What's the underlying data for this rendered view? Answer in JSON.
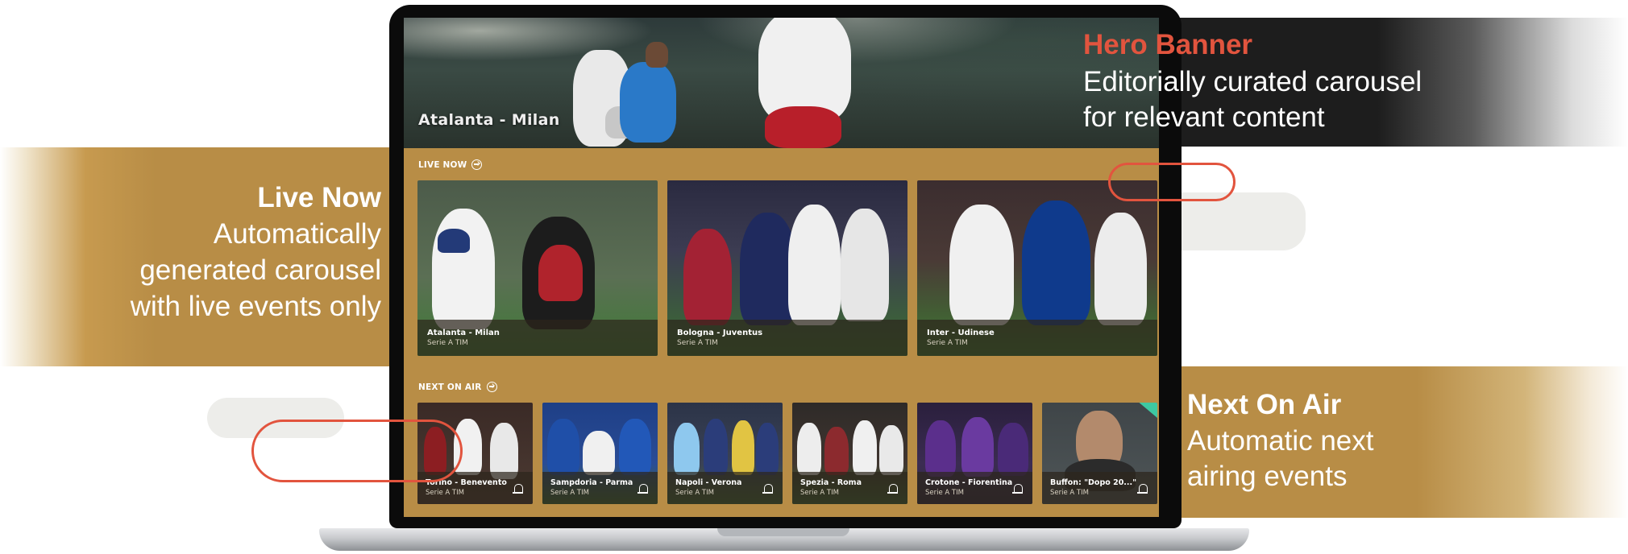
{
  "colors": {
    "gold": "#b88d46",
    "accent": "#e2543e",
    "dark_band": "#1d1d1d"
  },
  "hero": {
    "title": "Atalanta - Milan"
  },
  "live_now": {
    "heading": "LIVE NOW",
    "items": [
      {
        "title": "Atalanta - Milan",
        "subtitle": "Serie A TIM"
      },
      {
        "title": "Bologna - Juventus",
        "subtitle": "Serie A TIM"
      },
      {
        "title": "Inter - Udinese",
        "subtitle": "Serie A TIM"
      }
    ]
  },
  "next_on_air": {
    "heading": "NEXT ON AIR",
    "items": [
      {
        "title": "Torino - Benevento",
        "subtitle": "Serie A TIM"
      },
      {
        "title": "Sampdoria - Parma",
        "subtitle": "Serie A TIM"
      },
      {
        "title": "Napoli - Verona",
        "subtitle": "Serie A TIM"
      },
      {
        "title": "Spezia - Roma",
        "subtitle": "Serie A TIM"
      },
      {
        "title": "Crotone - Fiorentina",
        "subtitle": "Serie A TIM"
      },
      {
        "title": "Buffon: \"Dopo 20...\"",
        "subtitle": "Serie A TIM"
      }
    ]
  },
  "annotations": {
    "hero": {
      "title": "Hero Banner",
      "line1": "Editorially curated carousel",
      "line2": "for relevant content"
    },
    "live": {
      "title": "Live Now",
      "line1": "Automatically",
      "line2": "generated carousel",
      "line3": "with live events only"
    },
    "next": {
      "title": "Next On Air",
      "line1": "Automatic next",
      "line2": "airing events"
    }
  }
}
